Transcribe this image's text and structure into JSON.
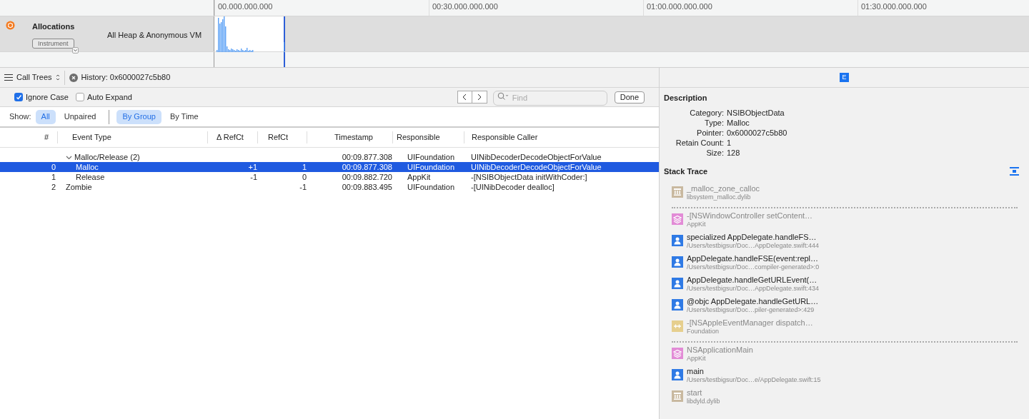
{
  "timeline": {
    "ruler": [
      "00.000.000.000",
      "00:30.000.000.000",
      "01:00.000.000.000",
      "01:30.000.000.000"
    ],
    "track": {
      "name": "Allocations",
      "badge": "Instrument",
      "detail": "All Heap & Anonymous VM"
    }
  },
  "toolbar": {
    "view": "Call Trees",
    "history": "History: 0x6000027c5b80"
  },
  "find_bar": {
    "options": [
      {
        "label": "Ignore Case",
        "checked": true
      },
      {
        "label": "Auto Expand",
        "checked": false
      }
    ],
    "placeholder": "Find",
    "done": "Done"
  },
  "show_bar": {
    "label": "Show:",
    "filters": [
      {
        "label": "All",
        "selected": true
      },
      {
        "label": "Unpaired",
        "selected": false
      }
    ],
    "grouping": [
      {
        "label": "By Group",
        "selected": true
      },
      {
        "label": "By Time",
        "selected": false
      }
    ]
  },
  "table": {
    "columns": [
      "#",
      "Event Type",
      "Δ RefCt",
      "RefCt",
      "Timestamp",
      "Responsible",
      "Responsible Caller"
    ],
    "rows": [
      {
        "index": "",
        "event": "Malloc/Release (2)",
        "delta": "",
        "refct": "",
        "timestamp": "00:09.877.308",
        "responsible": "UIFoundation",
        "caller": "UINibDecoderDecodeObjectForValue",
        "selected": false,
        "expanded": true,
        "children": [
          {
            "index": "0",
            "event": "Malloc",
            "delta": "+1",
            "refct": "1",
            "timestamp": "00:09.877.308",
            "responsible": "UIFoundation",
            "caller": "UINibDecoderDecodeObjectForValue",
            "selected": true
          },
          {
            "index": "1",
            "event": "Release",
            "delta": "-1",
            "refct": "0",
            "timestamp": "00:09.882.720",
            "responsible": "AppKit",
            "caller": "-[NSIBObjectData initWithCoder:]",
            "selected": false
          }
        ]
      },
      {
        "index": "2",
        "event": "Zombie",
        "delta": "",
        "refct": "-1",
        "timestamp": "00:09.883.495",
        "responsible": "UIFoundation",
        "caller": "-[UINibDecoder dealloc]",
        "selected": false
      }
    ]
  },
  "inspector": {
    "tab": "E",
    "description_title": "Description",
    "fields": [
      {
        "label": "Category:",
        "value": "NSIBObjectData"
      },
      {
        "label": "Type:",
        "value": "Malloc"
      },
      {
        "label": "Pointer:",
        "value": "0x6000027c5b80"
      },
      {
        "label": "Retain Count:",
        "value": "1"
      },
      {
        "label": "Size:",
        "value": "128"
      }
    ],
    "stack_title": "Stack Trace",
    "stack_groups": [
      {
        "frames": [
          {
            "kind": "library",
            "symbol": "_malloc_zone_calloc",
            "location": "libsystem_malloc.dylib"
          }
        ]
      },
      {
        "frames": [
          {
            "kind": "framework",
            "symbol": "-[NSWindowController setContent…",
            "location": "AppKit"
          },
          {
            "kind": "user",
            "symbol": "specialized AppDelegate.handleFS…",
            "location": "/Users/testbigsur/Doc…AppDelegate.swift:444"
          },
          {
            "kind": "user",
            "symbol": "AppDelegate.handleFSE(event:repl…",
            "location": "/Users/testbigsur/Doc…compiler-generated>:0"
          },
          {
            "kind": "user",
            "symbol": "AppDelegate.handleGetURLEvent(…",
            "location": "/Users/testbigsur/Doc…AppDelegate.swift:434"
          },
          {
            "kind": "user",
            "symbol": "@objc AppDelegate.handleGetURL…",
            "location": "/Users/testbigsur/Doc…piler-generated>:429"
          },
          {
            "kind": "foundation",
            "symbol": "-[NSAppleEventManager dispatch…",
            "location": "Foundation"
          }
        ]
      },
      {
        "frames": [
          {
            "kind": "framework",
            "symbol": "NSApplicationMain",
            "location": "AppKit"
          },
          {
            "kind": "user",
            "symbol": "main",
            "location": "/Users/testbigsur/Doc…e/AppDelegate.swift:15"
          },
          {
            "kind": "library",
            "symbol": "start",
            "location": "libdyld.dylib"
          }
        ]
      }
    ]
  }
}
